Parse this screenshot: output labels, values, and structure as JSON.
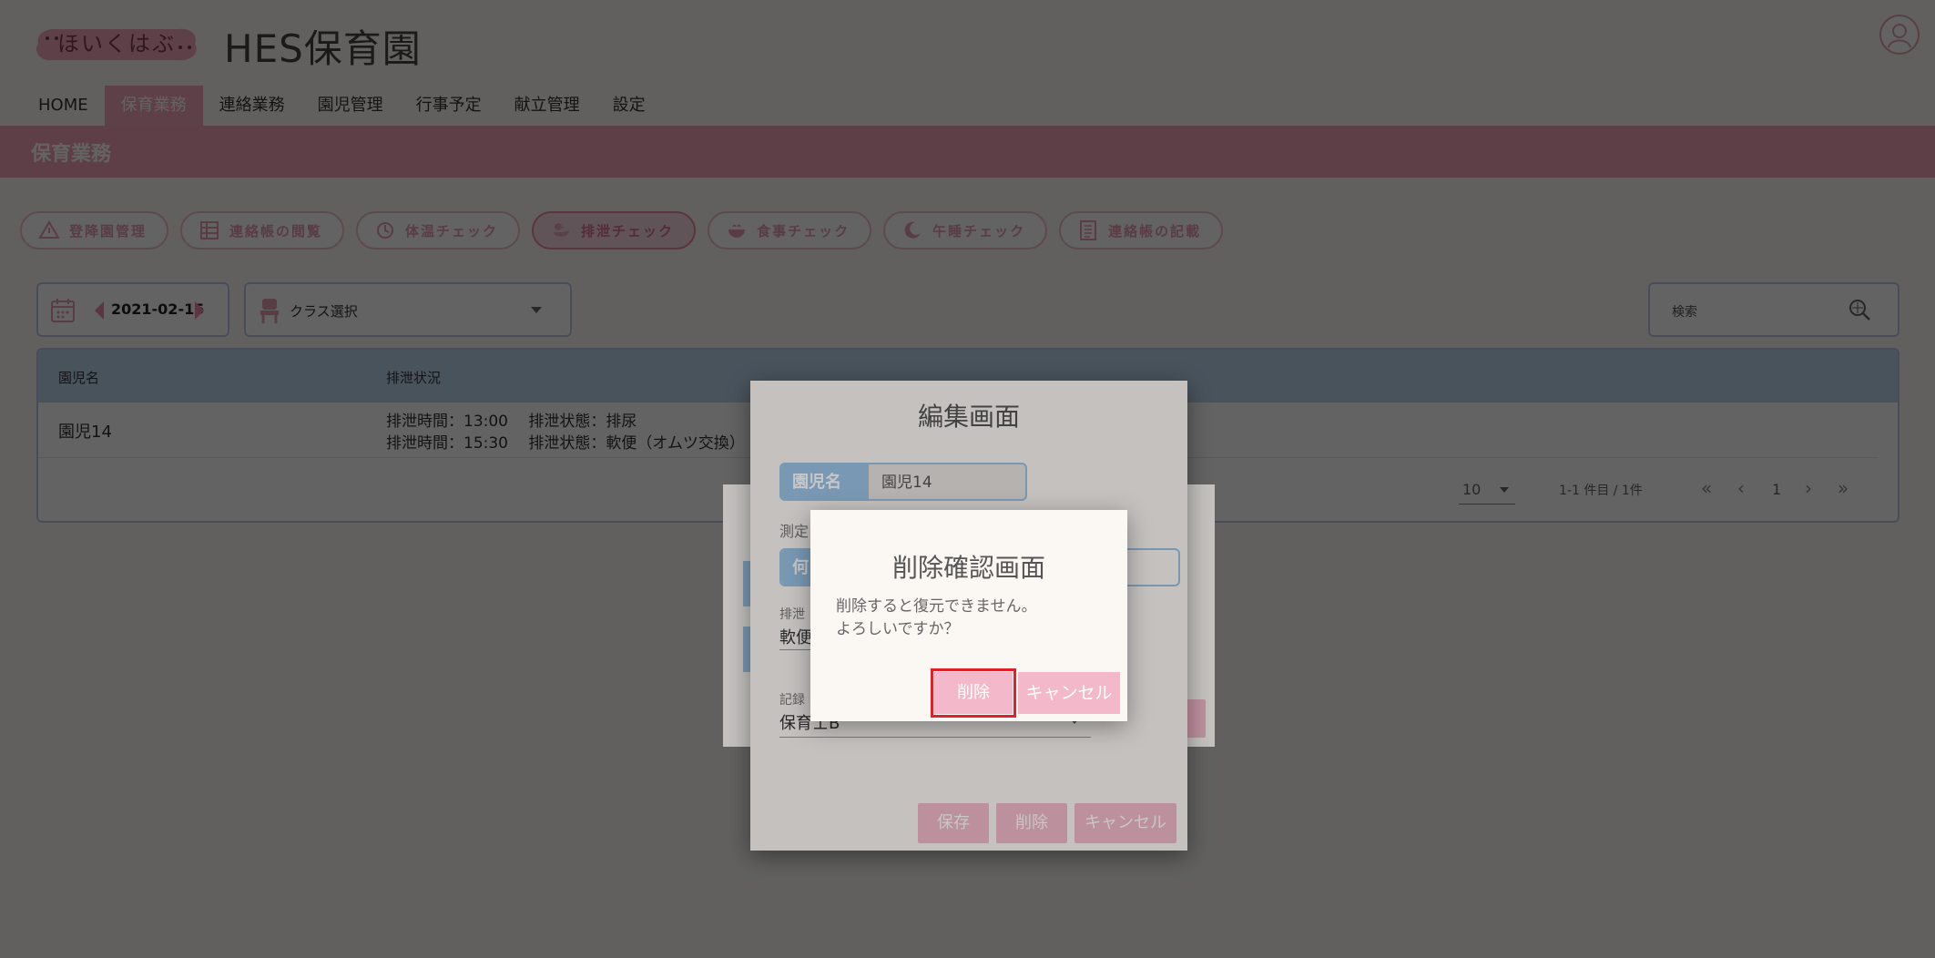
{
  "header": {
    "logo_text": "ほいくはぶ",
    "app_title": "HES保育園"
  },
  "nav": {
    "items": [
      {
        "label": "HOME",
        "active": false
      },
      {
        "label": "保育業務",
        "active": true
      },
      {
        "label": "連絡業務",
        "active": false
      },
      {
        "label": "園児管理",
        "active": false
      },
      {
        "label": "行事予定",
        "active": false
      },
      {
        "label": "献立管理",
        "active": false
      },
      {
        "label": "設定",
        "active": false
      }
    ]
  },
  "section": {
    "title": "保育業務"
  },
  "pills": [
    {
      "label": "登降園管理",
      "icon": "warning-icon"
    },
    {
      "label": "連絡帳の閲覧",
      "icon": "grid-icon"
    },
    {
      "label": "体温チェック",
      "icon": "thermometer-icon"
    },
    {
      "label": "排泄チェック",
      "icon": "duck-icon",
      "active": true
    },
    {
      "label": "食事チェック",
      "icon": "bowl-icon"
    },
    {
      "label": "午睡チェック",
      "icon": "moon-icon"
    },
    {
      "label": "連絡帳の記載",
      "icon": "notebook-icon"
    }
  ],
  "filters": {
    "date": "2021-02-15",
    "class_select": "クラス選択",
    "search_placeholder": "検索"
  },
  "table": {
    "headers": [
      "園児名",
      "排泄状況"
    ],
    "rows": [
      {
        "name": "園児14",
        "lines": [
          "排泄時間：13:00　 排泄状態：排尿",
          "排泄時間：15:30　 排泄状態：軟便（オムツ交換）"
        ]
      }
    ],
    "pagination": {
      "page_size": "10",
      "range_text": "1-1 件目 / 1件",
      "current_page": "1"
    }
  },
  "edit_dialog": {
    "title": "編集画面",
    "child_label": "園児名",
    "child_value": "園児14",
    "measure_label": "測定",
    "time_label_partial": "何",
    "status_label_partial": "排泄",
    "status_value_partial": "軟便",
    "recorder_label_partial": "記録",
    "recorder_value": "保育士B",
    "save_label": "保存",
    "delete_label": "削除",
    "cancel_label": "キャンセル"
  },
  "confirm_dialog": {
    "title": "削除確認画面",
    "message_line1": "削除すると復元できません。",
    "message_line2": "よろしいですか？",
    "delete_label": "削除",
    "cancel_label": "キャンセル"
  },
  "colors": {
    "brand_pink": "#f3a6bc",
    "button_pink": "#f3b9ca",
    "table_header_blue": "#bcd6ef",
    "highlight_red": "#e0212b"
  }
}
